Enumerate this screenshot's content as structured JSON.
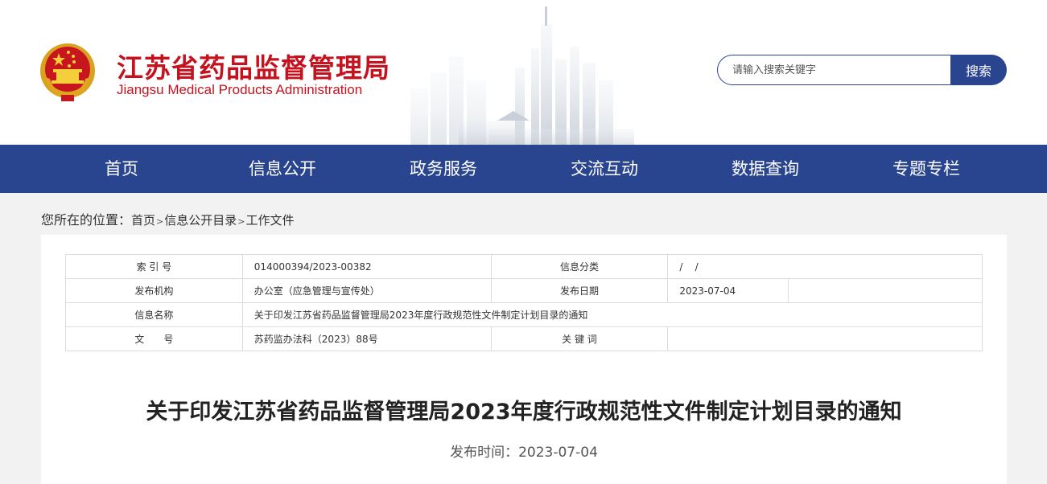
{
  "header": {
    "title_cn": "江苏省药品监督管理局",
    "title_en": "Jiangsu Medical Products Administration"
  },
  "search": {
    "placeholder": "请输入搜索关键字",
    "button_label": "搜索"
  },
  "nav": {
    "items": [
      "首页",
      "信息公开",
      "政务服务",
      "交流互动",
      "数据查询",
      "专题专栏"
    ]
  },
  "breadcrumb": {
    "label": "您所在的位置：",
    "items": [
      "首页",
      "信息公开目录",
      "工作文件"
    ],
    "separator": ">"
  },
  "info_table": {
    "index_label": "索 引 号",
    "index_value": "014000394/2023-00382",
    "category_label": "信息分类",
    "category_value": "/    /",
    "publisher_label": "发布机构",
    "publisher_value": "办公室（应急管理与宣传处）",
    "date_label": "发布日期",
    "date_value": "2023-07-04",
    "name_label": "信息名称",
    "name_value": "关于印发江苏省药品监督管理局2023年度行政规范性文件制定计划目录的通知",
    "docno_label": "文　　号",
    "docno_value": "苏药监办法科（2023）88号",
    "keywords_label": "关 键 词",
    "keywords_value": ""
  },
  "article": {
    "title": "关于印发江苏省药品监督管理局2023年度行政规范性文件制定计划目录的通知",
    "pub_time_label": "发布时间：",
    "pub_time_value": "2023-07-04"
  },
  "colors": {
    "brand_red": "#c4121f",
    "nav_blue": "#2a4590"
  }
}
